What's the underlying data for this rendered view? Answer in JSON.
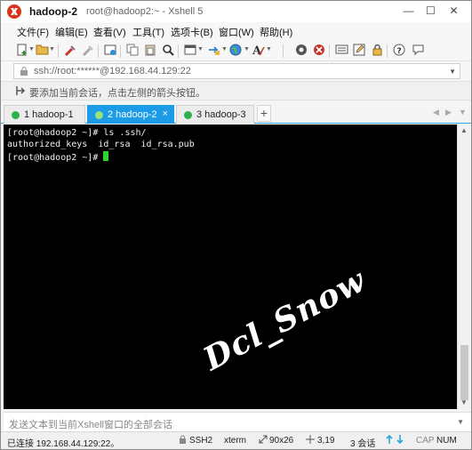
{
  "window": {
    "title": "hadoop-2",
    "subtitle": "root@hadoop2:~ - Xshell 5",
    "minimize": "—",
    "maximize": "☐",
    "close": "✕"
  },
  "menu": [
    "文件(F)",
    "编辑(E)",
    "查看(V)",
    "工具(T)",
    "选项卡(B)",
    "窗口(W)",
    "帮助(H)"
  ],
  "address": {
    "text": "ssh://root:******@192.168.44.129:22"
  },
  "hint": {
    "text": "要添加当前会话，点击左侧的箭头按钮。"
  },
  "tabs": [
    {
      "num": "1",
      "label": "1 hadoop-1"
    },
    {
      "num": "2",
      "label": "2 hadoop-2",
      "close": "×"
    },
    {
      "num": "3",
      "label": "3 hadoop-3"
    }
  ],
  "tab_add": "+",
  "terminal": {
    "lines": [
      "[root@hadoop2 ~]# ls .ssh/",
      "authorized_keys  id_rsa  id_rsa.pub",
      "[root@hadoop2 ~]# "
    ],
    "watermark": "Dcl_Snow",
    "cursor_color": "#2bd52b"
  },
  "send_bar": {
    "placeholder": "发送文本到当前Xshell窗口的全部会话"
  },
  "status": {
    "connection": "已连接 192.168.44.129:22。",
    "protocol": "SSH2",
    "terminal": "xterm",
    "size": "90x26",
    "position": "3,19",
    "sessions": "3 会话",
    "cap": "CAP",
    "num": "NUM"
  },
  "colors": {
    "active_tab": "#1c9be6",
    "session_dot": "#2bb24c",
    "terminal_bg": "#000000"
  }
}
